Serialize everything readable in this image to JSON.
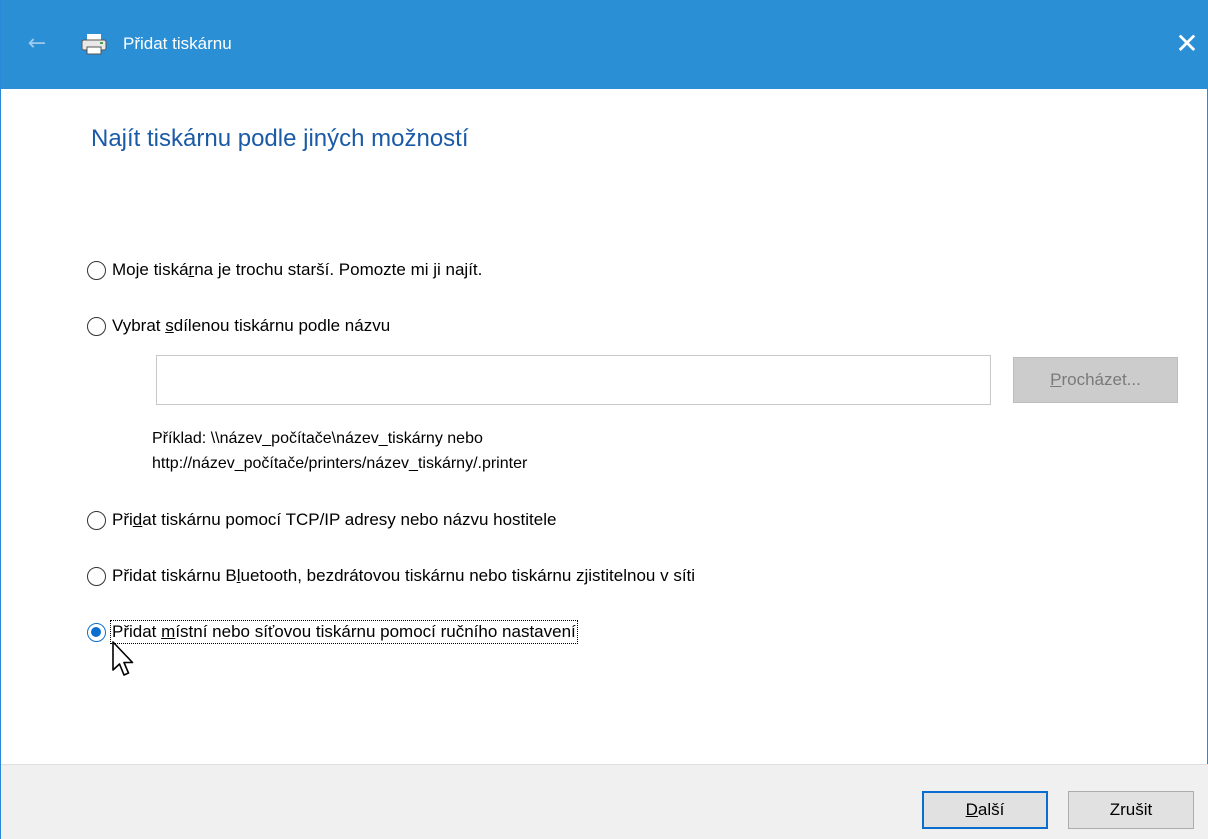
{
  "window": {
    "title": "Přidat tiskárnu",
    "back_icon": "back-arrow-icon",
    "close_icon": "close-icon"
  },
  "heading": "Najít tiskárnu podle jiných možností",
  "options": [
    {
      "pre": "Moje tiská",
      "ul": "r",
      "post": "na je trochu starší. Pomozte mi ji najít.",
      "checked": false
    },
    {
      "pre": "Vybrat ",
      "ul": "s",
      "post": "dílenou tiskárnu podle názvu",
      "checked": false
    },
    {
      "pre": "Při",
      "ul": "d",
      "post": "at tiskárnu pomocí TCP/IP adresy nebo názvu hostitele",
      "checked": false
    },
    {
      "pre": "Přidat tiskárnu B",
      "ul": "l",
      "post": "uetooth, bezdrátovou tiskárnu nebo tiskárnu zjistitelnou v síti",
      "checked": false
    },
    {
      "pre": "Přidat ",
      "ul": "m",
      "post": "ístní nebo síťovou tiskárnu pomocí ručního nastavení",
      "checked": true
    }
  ],
  "share_input": {
    "value": ""
  },
  "browse_button": {
    "ul": "P",
    "rest": "rocházet..."
  },
  "example": {
    "line1": "Příklad: \\\\název_počítače\\název_tiskárny nebo",
    "line2": "http://název_počítače/printers/název_tiskárny/.printer"
  },
  "footer": {
    "next": {
      "ul": "D",
      "rest": "alší"
    },
    "cancel": "Zrušit"
  },
  "colors": {
    "titlebar": "#2b8fd6",
    "heading": "#1a5aa6",
    "accent": "#0a6ed1"
  }
}
